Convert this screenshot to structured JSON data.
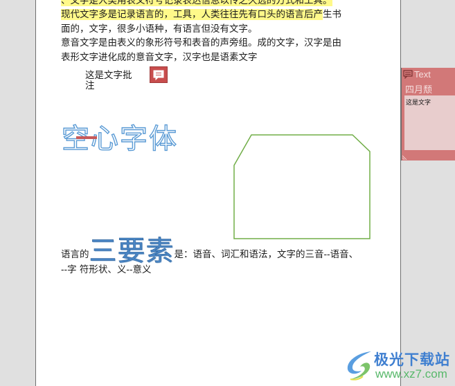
{
  "document": {
    "paragraphs": {
      "line1": "、文字是人类用表义符号记录表达信息以传之久远的方式和工具。",
      "line2_highlighted": "现代文字多是记录语言的，工具，人类往往先有口头的语言后产",
      "line2_rest": "生书",
      "line3": "面的，文字，很多小语种，有语言但没有文字。",
      "line4": "意音文字是由表义的象形符号和表音的声旁组。成的文字，汉字是由",
      "line5": "表形文字进化成的意音文字，汉字也是语素文字"
    },
    "comment_anchor_text": "这是文字批注",
    "hollow_text": "空心字体",
    "elements_line": {
      "prefix": "语言的",
      "emphasis": "三要素",
      "suffix": "是：语音、词汇和语法，文字的三音--语音、",
      "line2": "--字  符形状、义--意义"
    },
    "shape": {
      "type": "snip-corner-rectangle",
      "outline_color": "#70ad47"
    }
  },
  "note_panel": {
    "header_label": "Text",
    "author": "四月颓",
    "body": "这是文字",
    "color": "#d27878"
  },
  "watermark": {
    "title": "极光下载站",
    "url": "www.xz7.com"
  },
  "colors": {
    "highlight": "#fff98a",
    "hollow_outline": "#5b9bd5",
    "comment_icon": "#c84d4d"
  }
}
